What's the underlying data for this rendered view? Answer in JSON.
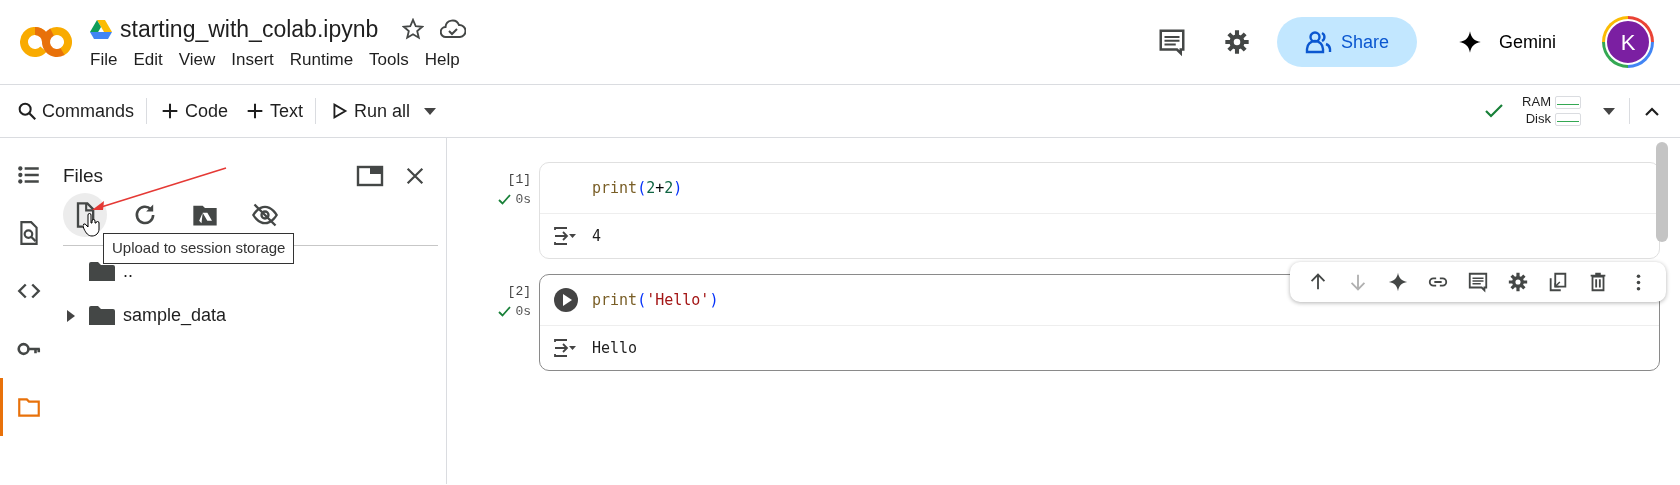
{
  "header": {
    "title": "starting_with_colab.ipynb",
    "menu": [
      "File",
      "Edit",
      "View",
      "Insert",
      "Runtime",
      "Tools",
      "Help"
    ],
    "share_label": "Share",
    "gemini_label": "Gemini",
    "avatar_letter": "K"
  },
  "toolbar": {
    "buttons": [
      {
        "kind": "search",
        "label": "Commands"
      },
      {
        "kind": "add",
        "label": "Code"
      },
      {
        "kind": "add",
        "label": "Text"
      },
      {
        "kind": "run",
        "label": "Run all"
      }
    ],
    "connected": true,
    "ram_label": "RAM",
    "disk_label": "Disk"
  },
  "sidebar": {
    "items": [
      {
        "kind": "toc",
        "selected": false
      },
      {
        "kind": "find",
        "selected": false
      },
      {
        "kind": "code",
        "selected": false
      },
      {
        "kind": "key",
        "selected": false
      },
      {
        "kind": "files",
        "selected": true
      }
    ]
  },
  "files_panel": {
    "title": "Files",
    "tooltip": "Upload to session storage",
    "tree": [
      {
        "name": "..",
        "expandable": false
      },
      {
        "name": "sample_data",
        "expandable": true
      }
    ]
  },
  "cells": [
    {
      "execution_count": "[1]",
      "duration": "0s",
      "focused": false,
      "code": [
        {
          "kind": "fn",
          "text": "print"
        },
        {
          "kind": "paren",
          "text": "("
        },
        {
          "kind": "num",
          "text": "2"
        },
        {
          "kind": "op",
          "text": "+"
        },
        {
          "kind": "num",
          "text": "2"
        },
        {
          "kind": "paren",
          "text": ")"
        }
      ],
      "output": "4"
    },
    {
      "execution_count": "[2]",
      "duration": "0s",
      "focused": true,
      "code": [
        {
          "kind": "fn",
          "text": "print"
        },
        {
          "kind": "paren",
          "text": "("
        },
        {
          "kind": "str",
          "text": "'Hello'"
        },
        {
          "kind": "paren",
          "text": ")"
        }
      ],
      "output": "Hello"
    }
  ],
  "cell_toolbar": [
    {
      "kind": "up",
      "disabled": false
    },
    {
      "kind": "down",
      "disabled": true
    },
    {
      "kind": "sparkle",
      "disabled": false
    },
    {
      "kind": "link",
      "disabled": false
    },
    {
      "kind": "comment",
      "disabled": false
    },
    {
      "kind": "gear",
      "disabled": false
    },
    {
      "kind": "mirror",
      "disabled": false
    },
    {
      "kind": "trash",
      "disabled": false
    },
    {
      "kind": "more",
      "disabled": false
    }
  ]
}
